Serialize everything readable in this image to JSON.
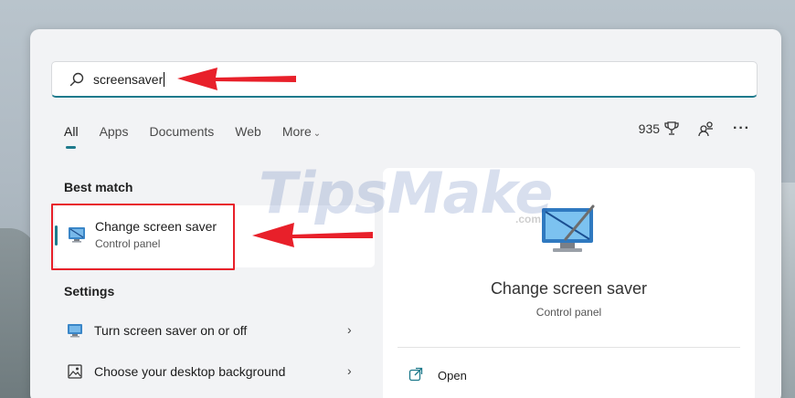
{
  "search": {
    "query": "screensaver"
  },
  "tabs": [
    {
      "label": "All",
      "active": true
    },
    {
      "label": "Apps"
    },
    {
      "label": "Documents"
    },
    {
      "label": "Web"
    },
    {
      "label": "More"
    }
  ],
  "header_right": {
    "points": "935"
  },
  "best_match": {
    "heading": "Best match",
    "title": "Change screen saver",
    "subtitle": "Control panel"
  },
  "settings": {
    "heading": "Settings",
    "items": [
      {
        "label": "Turn screen saver on or off",
        "icon": "screensaver-icon"
      },
      {
        "label": "Choose your desktop background",
        "icon": "picture-icon"
      }
    ]
  },
  "preview": {
    "title": "Change screen saver",
    "subtitle": "Control panel",
    "actions": [
      {
        "label": "Open",
        "icon": "open-external-icon"
      }
    ]
  },
  "watermark": {
    "text": "TipsMake",
    "suffix": ".com"
  },
  "colors": {
    "accent": "#1e7a8c",
    "annotation_red": "#e8202a"
  }
}
